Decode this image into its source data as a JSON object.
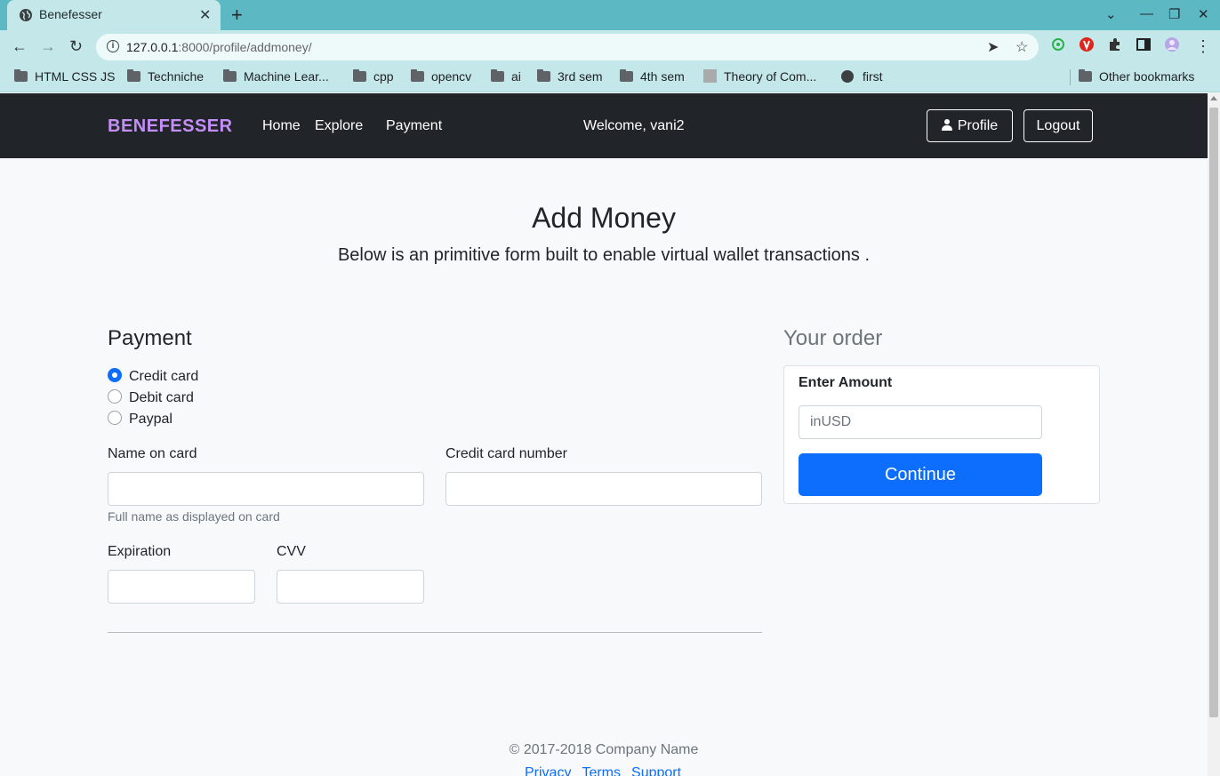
{
  "browser": {
    "tab_title": "Benefesser",
    "url_host": "127.0.0.1",
    "url_rest": ":8000/profile/addmoney/",
    "bookmarks": [
      "HTML CSS JS",
      "Techniche",
      "Machine Lear...",
      "cpp",
      "opencv",
      "ai",
      "3rd sem",
      "4th sem",
      "Theory of Com...",
      "first"
    ],
    "other_bookmarks": "Other bookmarks"
  },
  "navbar": {
    "brand": "BENEFESSER",
    "links": [
      "Home",
      "Explore",
      "Payment"
    ],
    "welcome": "Welcome, vani2",
    "profile_label": "Profile",
    "logout_label": "Logout",
    "brand_color": "#c48ef7"
  },
  "header": {
    "title": "Add Money",
    "subtitle": "Below is an primitive form built to enable virtual wallet transactions ."
  },
  "payment": {
    "title": "Payment",
    "methods": [
      {
        "label": "Credit card",
        "checked": true
      },
      {
        "label": "Debit card",
        "checked": false
      },
      {
        "label": "Paypal",
        "checked": false
      }
    ],
    "name_label": "Name on card",
    "name_help": "Full name as displayed on card",
    "card_number_label": "Credit card number",
    "expiration_label": "Expiration",
    "cvv_label": "CVV"
  },
  "order": {
    "title": "Your order",
    "amount_label": "Enter Amount",
    "amount_placeholder": "inUSD",
    "continue_label": "Continue",
    "accent_color": "#0d6efd"
  },
  "footer": {
    "copyright": "© 2017-2018 Company Name",
    "links": [
      "Privacy",
      "Terms",
      "Support"
    ]
  }
}
